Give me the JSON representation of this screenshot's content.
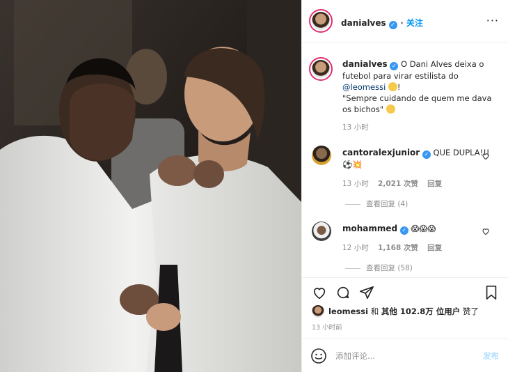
{
  "post": {
    "author": "danialves",
    "follow_label": "关注",
    "more_label": "···",
    "caption": {
      "author": "danialves",
      "text1": "O Dani Alves deixa o futebol para virar estilista do",
      "mention": "@leomessi",
      "emoji1": "😂",
      "text2": "!",
      "text3": "\"Sempre cuidando de quem me dava os bichos\"",
      "emoji2": "😂",
      "time": "13 小时"
    },
    "comments": [
      {
        "user": "cantoralexjunior",
        "text": "QUE DUPLA!!!",
        "emojis": "⚽💥",
        "time": "13 小时",
        "likes": "2,021 次赞",
        "reply_label": "回复",
        "view_replies": "查看回复 (4)"
      },
      {
        "user": "mohammed",
        "text": "",
        "emojis": "😱😱😱",
        "time": "12 小时",
        "likes": "1,168 次赞",
        "reply_label": "回复",
        "view_replies": "查看回复 (58)"
      }
    ],
    "likes": {
      "user": "leomessi",
      "and": "和",
      "others": "其他 102.8万 位用户",
      "suffix": "赞了"
    },
    "timestamp": "13 小时前",
    "add_comment": {
      "placeholder": "添加评论...",
      "post_label": "发布"
    }
  },
  "icons": {
    "verified": "verified-badge-icon",
    "like": "heart-icon",
    "comment": "comment-icon",
    "share": "send-icon",
    "save": "bookmark-icon",
    "emoji": "smiley-icon"
  },
  "colors": {
    "link": "#0095f6",
    "verified": "#3897f0",
    "muted": "#8e8e8e",
    "mention": "#00376b",
    "post_disabled": "#b2dffc",
    "story_ring": "#e1306c"
  }
}
